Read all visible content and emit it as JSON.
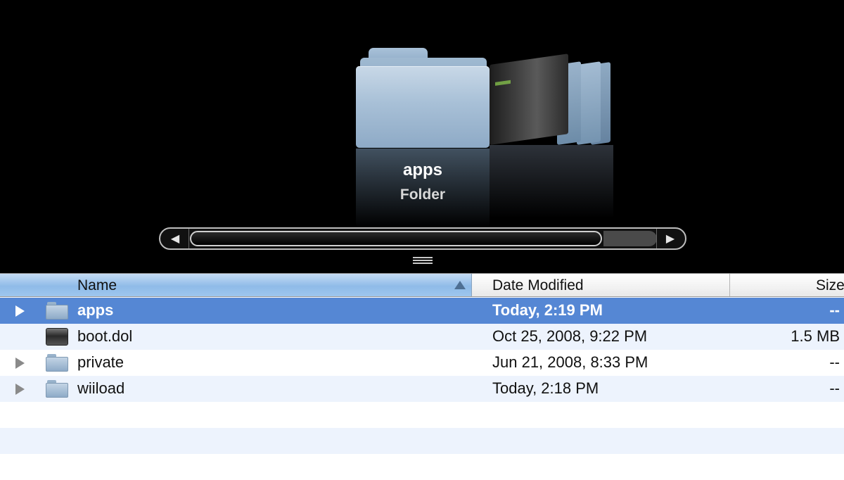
{
  "coverflow": {
    "title": "apps",
    "kind": "Folder",
    "scroll_left": "◀",
    "scroll_right": "▶"
  },
  "list": {
    "columns": {
      "name": "Name",
      "date": "Date Modified",
      "size": "Size"
    },
    "rows": [
      {
        "name": "apps",
        "date": "Today, 2:19 PM",
        "size": "--",
        "type": "folder",
        "selected": true
      },
      {
        "name": "boot.dol",
        "date": "Oct 25, 2008, 9:22 PM",
        "size": "1.5 MB",
        "type": "file",
        "selected": false
      },
      {
        "name": "private",
        "date": "Jun 21, 2008, 8:33 PM",
        "size": "--",
        "type": "folder",
        "selected": false
      },
      {
        "name": "wiiload",
        "date": "Today, 2:18 PM",
        "size": "--",
        "type": "folder",
        "selected": false
      }
    ]
  },
  "colors": {
    "selection": "#5587d4",
    "alt_row": "#edf3fd",
    "coverflow_bg": "#000000"
  },
  "icons": [
    "folder-icon",
    "document-icon",
    "disclosure-triangle-icon",
    "sort-ascending-icon"
  ]
}
